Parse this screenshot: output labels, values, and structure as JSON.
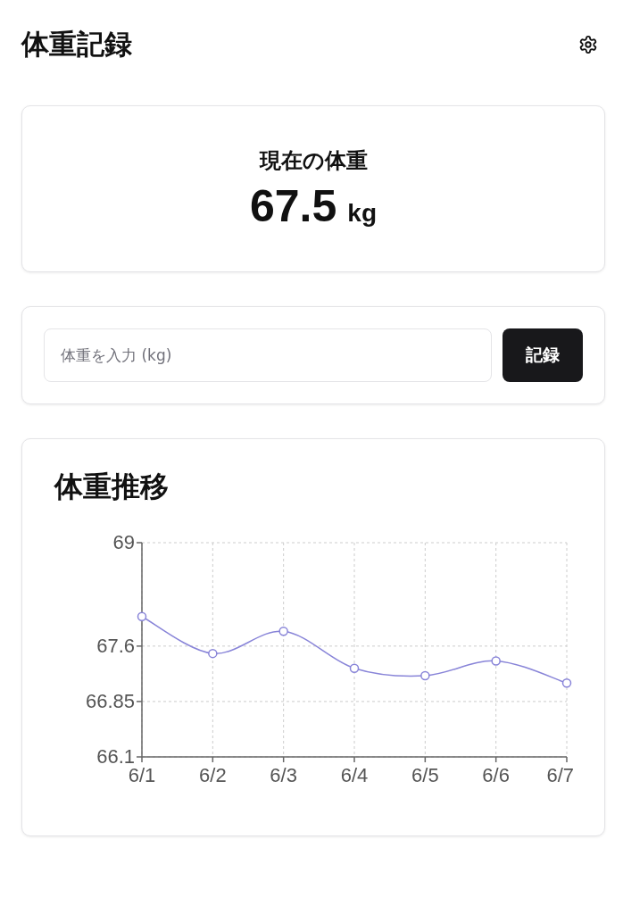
{
  "header": {
    "title": "体重記録"
  },
  "current": {
    "label": "現在の体重",
    "value": "67.5",
    "unit": "kg"
  },
  "entry": {
    "placeholder": "体重を入力 (kg)",
    "button": "記録"
  },
  "chart": {
    "chart_data": {
      "type": "line",
      "title": "体重推移",
      "categories": [
        "6/1",
        "6/2",
        "6/3",
        "6/4",
        "6/5",
        "6/6",
        "6/7"
      ],
      "grid": true,
      "series": [
        {
          "color": "#8884d8",
          "marker": true,
          "values": [
            68.0,
            67.5,
            67.8,
            67.3,
            67.2,
            67.4,
            67.1
          ]
        }
      ],
      "ylim": [
        66.1,
        69
      ],
      "yticks": [
        66.1,
        66.85,
        67.6,
        69
      ]
    }
  }
}
